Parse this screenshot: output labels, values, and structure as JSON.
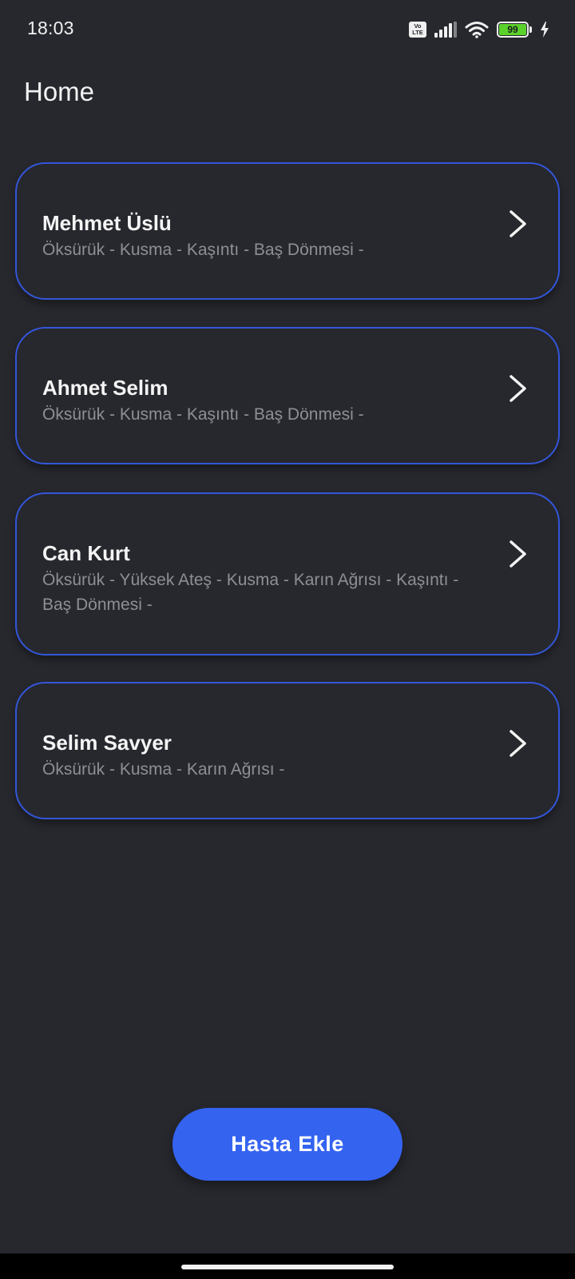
{
  "status_bar": {
    "time": "18:03",
    "volte_top": "Vo",
    "volte_bottom": "LTE",
    "battery_level": "99",
    "icons": [
      "volte-icon",
      "signal-icon",
      "wifi-icon",
      "battery-icon",
      "charging-icon"
    ]
  },
  "header": {
    "title": "Home"
  },
  "patients": [
    {
      "name": "Mehmet Üslü",
      "symptoms": "Öksürük - Kusma - Kaşıntı - Baş Dönmesi -"
    },
    {
      "name": "Ahmet Selim",
      "symptoms": "Öksürük - Kusma - Kaşıntı - Baş Dönmesi -"
    },
    {
      "name": "Can Kurt",
      "symptoms": "Öksürük - Yüksek Ateş - Kusma - Karın Ağrısı - Kaşıntı - Baş Dönmesi -"
    },
    {
      "name": "Selim Savyer",
      "symptoms": "Öksürük - Kusma - Karın Ağrısı -"
    }
  ],
  "actions": {
    "add_patient_label": "Hasta Ekle"
  },
  "colors": {
    "background": "#27282e",
    "card_border": "#3356d9",
    "primary_button": "#3463f0",
    "symptom_text": "#8e8f95",
    "battery": "#5bd12b"
  }
}
